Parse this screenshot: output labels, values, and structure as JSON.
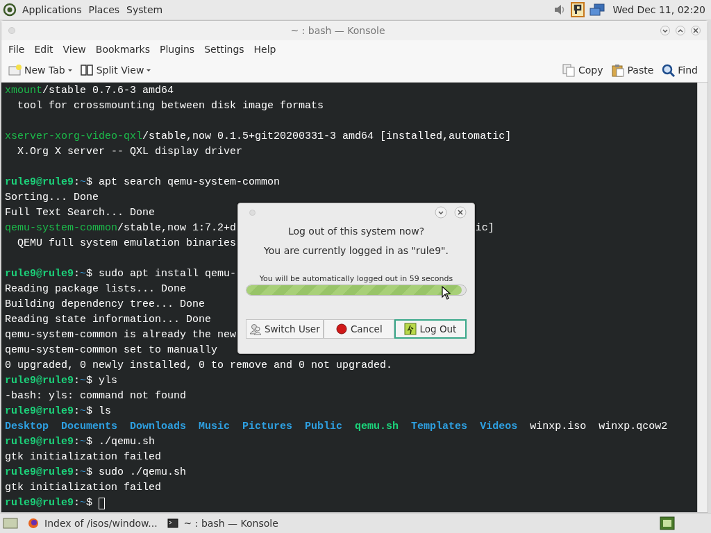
{
  "top_panel": {
    "menus": [
      "Applications",
      "Places",
      "System"
    ],
    "clock": "Wed Dec 11, 02:20"
  },
  "window": {
    "title": "~ : bash — Konsole"
  },
  "menu_bar": [
    "File",
    "Edit",
    "View",
    "Bookmarks",
    "Plugins",
    "Settings",
    "Help"
  ],
  "toolbar": {
    "left": [
      {
        "label": "New Tab",
        "kind": "new-tab",
        "dropdown": true
      },
      {
        "label": "Split View",
        "kind": "split",
        "dropdown": true
      }
    ],
    "right": [
      {
        "label": "Copy",
        "kind": "copy"
      },
      {
        "label": "Paste",
        "kind": "paste"
      },
      {
        "label": "Find",
        "kind": "find"
      }
    ]
  },
  "terminal": {
    "lines": [
      {
        "segments": [
          {
            "text": "xmount",
            "kind": "pkg"
          },
          {
            "text": "/stable 0.7.6-3 amd64",
            "kind": "plain"
          }
        ]
      },
      {
        "segments": [
          {
            "text": "  tool for crossmounting between disk image formats",
            "kind": "plain"
          }
        ]
      },
      {
        "kind": "blank"
      },
      {
        "segments": [
          {
            "text": "xserver-xorg-video-qxl",
            "kind": "pkg"
          },
          {
            "text": "/stable,now 0.1.5+git20200331-3 amd64 [installed,automatic]",
            "kind": "plain"
          }
        ]
      },
      {
        "segments": [
          {
            "text": "  X.Org X server -- QXL display driver",
            "kind": "plain"
          }
        ]
      },
      {
        "kind": "blank"
      },
      {
        "segments": [
          {
            "text": "rule9@rule9",
            "kind": "user"
          },
          {
            "text": ":",
            "kind": "plain"
          },
          {
            "text": "~",
            "kind": "path"
          },
          {
            "text": "$ apt search qemu-system-common",
            "kind": "plain"
          }
        ]
      },
      {
        "segments": [
          {
            "text": "Sorting... Done",
            "kind": "plain"
          }
        ]
      },
      {
        "segments": [
          {
            "text": "Full Text Search... Done",
            "kind": "plain"
          }
        ]
      },
      {
        "segments": [
          {
            "text": "qemu-system-common",
            "kind": "pkg"
          },
          {
            "text": "/stable,now 1:7.2+d",
            "kind": "plain"
          },
          {
            "text": "ic]",
            "kind": "tail"
          }
        ]
      },
      {
        "segments": [
          {
            "text": "  QEMU full system emulation binaries",
            "kind": "plain"
          }
        ]
      },
      {
        "kind": "blank"
      },
      {
        "segments": [
          {
            "text": "rule9@rule9",
            "kind": "user"
          },
          {
            "text": ":",
            "kind": "plain"
          },
          {
            "text": "~",
            "kind": "path"
          },
          {
            "text": "$ sudo apt install qemu-",
            "kind": "plain"
          }
        ]
      },
      {
        "segments": [
          {
            "text": "Reading package lists... Done",
            "kind": "plain"
          }
        ]
      },
      {
        "segments": [
          {
            "text": "Building dependency tree... Done",
            "kind": "plain"
          }
        ]
      },
      {
        "segments": [
          {
            "text": "Reading state information... Done",
            "kind": "plain"
          }
        ]
      },
      {
        "segments": [
          {
            "text": "qemu-system-common is already the new",
            "kind": "plain"
          }
        ]
      },
      {
        "segments": [
          {
            "text": "qemu-system-common set to manually",
            "kind": "plain"
          }
        ]
      },
      {
        "segments": [
          {
            "text": "0 upgraded, 0 newly installed, 0 to remove and 0 not upgraded.",
            "kind": "plain"
          }
        ]
      },
      {
        "segments": [
          {
            "text": "rule9@rule9",
            "kind": "user"
          },
          {
            "text": ":",
            "kind": "plain"
          },
          {
            "text": "~",
            "kind": "path"
          },
          {
            "text": "$ yls",
            "kind": "plain"
          }
        ]
      },
      {
        "segments": [
          {
            "text": "-bash: yls: command not found",
            "kind": "plain"
          }
        ]
      },
      {
        "segments": [
          {
            "text": "rule9@rule9",
            "kind": "user"
          },
          {
            "text": ":",
            "kind": "plain"
          },
          {
            "text": "~",
            "kind": "path"
          },
          {
            "text": "$ ls",
            "kind": "plain"
          }
        ]
      },
      {
        "segments": [
          {
            "text": "Desktop",
            "kind": "dir"
          },
          {
            "text": "Documents",
            "kind": "dir"
          },
          {
            "text": "Downloads",
            "kind": "dir"
          },
          {
            "text": "Music",
            "kind": "dir"
          },
          {
            "text": "Pictures",
            "kind": "dir"
          },
          {
            "text": "Public",
            "kind": "dir"
          },
          {
            "text": "qemu.sh",
            "kind": "exec"
          },
          {
            "text": "Templates",
            "kind": "dir"
          },
          {
            "text": "Videos",
            "kind": "dir"
          },
          {
            "text": "winxp.iso",
            "kind": "file"
          },
          {
            "text": "winxp.qcow2",
            "kind": "file"
          }
        ]
      },
      {
        "segments": [
          {
            "text": "rule9@rule9",
            "kind": "user"
          },
          {
            "text": ":",
            "kind": "plain"
          },
          {
            "text": "~",
            "kind": "path"
          },
          {
            "text": "$ ./qemu.sh",
            "kind": "plain"
          }
        ]
      },
      {
        "segments": [
          {
            "text": "gtk initialization failed",
            "kind": "plain"
          }
        ]
      },
      {
        "segments": [
          {
            "text": "rule9@rule9",
            "kind": "user"
          },
          {
            "text": ":",
            "kind": "plain"
          },
          {
            "text": "~",
            "kind": "path"
          },
          {
            "text": "$ sudo ./qemu.sh",
            "kind": "plain"
          }
        ]
      },
      {
        "segments": [
          {
            "text": "gtk initialization failed",
            "kind": "plain"
          }
        ]
      },
      {
        "segments": [
          {
            "text": "rule9@rule9",
            "kind": "user"
          },
          {
            "text": ":",
            "kind": "plain"
          },
          {
            "text": "~",
            "kind": "path"
          },
          {
            "text": "$ ",
            "kind": "plain"
          }
        ],
        "cursor": true
      }
    ]
  },
  "dialog": {
    "question": "Log out of this system now?",
    "subtitle": "You are currently logged in as \"rule9\".",
    "countdown": "You will be automatically logged out in 59 seconds",
    "progress": {
      "level": 0.98
    },
    "buttons": [
      {
        "label": "Switch User",
        "kind": "switch-user",
        "selected": false
      },
      {
        "label": "Cancel",
        "kind": "cancel",
        "selected": false
      },
      {
        "label": "Log Out",
        "kind": "logout",
        "selected": true
      }
    ]
  },
  "taskbar": {
    "items": [
      {
        "label": "Index of /isos/window...",
        "kind": "browser"
      },
      {
        "label": "~ : bash — Konsole",
        "kind": "terminal"
      }
    ]
  }
}
